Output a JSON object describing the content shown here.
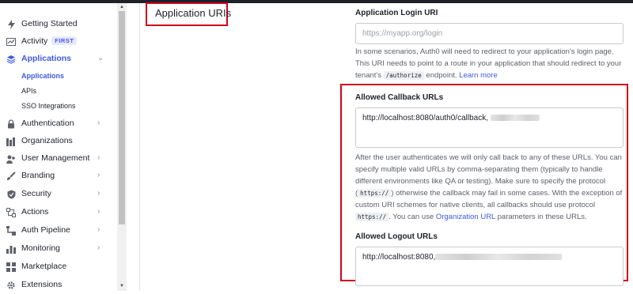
{
  "sidebar": {
    "items": [
      {
        "label": "Getting Started"
      },
      {
        "label": "Activity",
        "badge": "FIRST"
      },
      {
        "label": "Applications"
      },
      {
        "label": "Authentication"
      },
      {
        "label": "Organizations"
      },
      {
        "label": "User Management"
      },
      {
        "label": "Branding"
      },
      {
        "label": "Security"
      },
      {
        "label": "Actions"
      },
      {
        "label": "Auth Pipeline"
      },
      {
        "label": "Monitoring"
      },
      {
        "label": "Marketplace"
      },
      {
        "label": "Extensions"
      }
    ],
    "sub_items": [
      {
        "label": "Applications"
      },
      {
        "label": "APIs"
      },
      {
        "label": "SSO Integrations"
      }
    ]
  },
  "section": {
    "title": "Application URIs"
  },
  "login_uri": {
    "label": "Application Login URI",
    "placeholder": "https://myapp.org/login",
    "help_1": "In some scenarios, Auth0 will need to redirect to your application's login page. This URI needs to point to a route in your application that should redirect to your tenant's ",
    "help_code": "/authorize",
    "help_2": " endpoint. ",
    "help_link": "Learn more"
  },
  "callback": {
    "label": "Allowed Callback URLs",
    "value": "http://localhost:8080/auth0/callback,",
    "help_1": "After the user authenticates we will only call back to any of these URLs. You can specify multiple valid URLs by comma-separating them (typically to handle different environments like QA or testing). Make sure to specify the protocol (",
    "help_code1": "https://",
    "help_2": ") otherwise the callback may fail in some cases. With the exception of custom URI schemes for native clients, all callbacks should use protocol ",
    "help_code2": "https://",
    "help_3": ". You can use ",
    "help_link": "Organization URL",
    "help_4": " parameters in these URLs."
  },
  "logout": {
    "label": "Allowed Logout URLs",
    "value": "http://localhost:8080,"
  },
  "colors": {
    "accent": "#3f59e4",
    "highlight": "#d0021b"
  }
}
